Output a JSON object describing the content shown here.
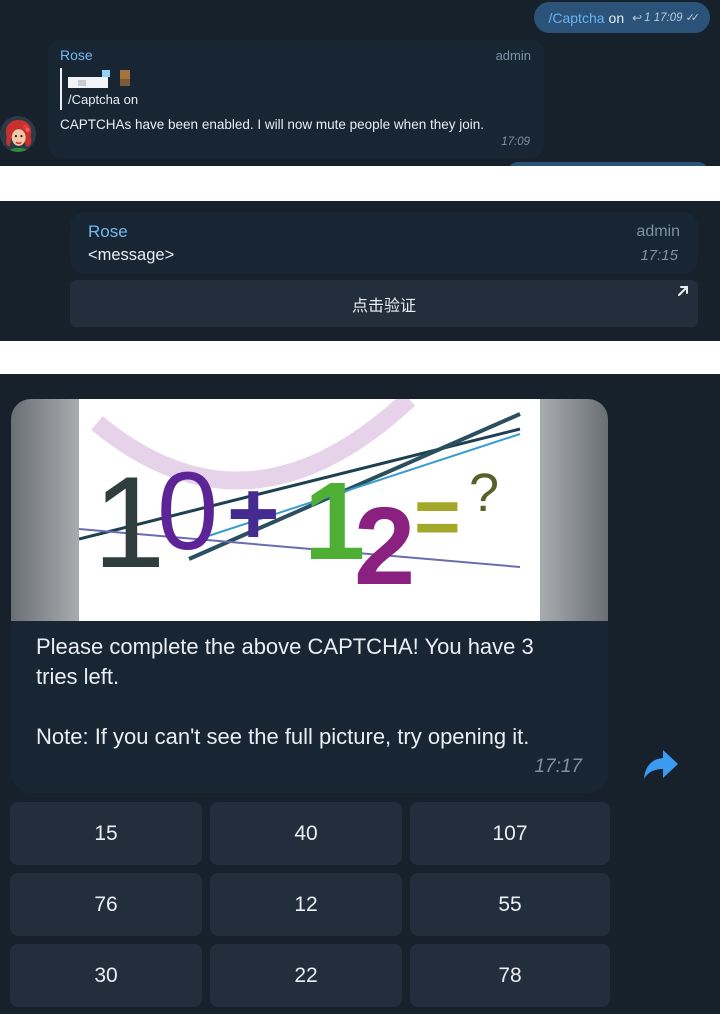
{
  "panel1": {
    "outgoing": {
      "command": "/Captcha",
      "arg": "on",
      "reply_count": "1",
      "time": "17:09"
    },
    "incoming": {
      "sender": "Rose",
      "role": "admin",
      "quoted_text": "/Captcha on",
      "text": "CAPTCHAs have been enabled. I will now mute people when they join.",
      "time": "17:09"
    }
  },
  "panel2": {
    "sender": "Rose",
    "role": "admin",
    "text": "<message>",
    "time": "17:15",
    "button_label": "点击验证"
  },
  "panel3": {
    "caption_line1": "Please complete the above CAPTCHA! You have 3 tries left.",
    "caption_line2": "Note: If you can't see the full picture, try opening it.",
    "time": "17:17",
    "captcha_text": "10+12=?",
    "answers": [
      "15",
      "40",
      "107",
      "76",
      "12",
      "55",
      "30",
      "22",
      "78"
    ]
  },
  "colors": {
    "background": "#17212b",
    "incoming_bubble": "#182533",
    "outgoing_bubble": "#2b5278",
    "link": "#6ab3f3",
    "sender_name": "#71b9f0",
    "keyboard_button": "#232e3c",
    "share_icon": "#3a9bf0"
  },
  "icons": [
    "reply-arrow-icon",
    "double-check-icon",
    "external-link-icon",
    "share-icon",
    "rose-avatar"
  ]
}
